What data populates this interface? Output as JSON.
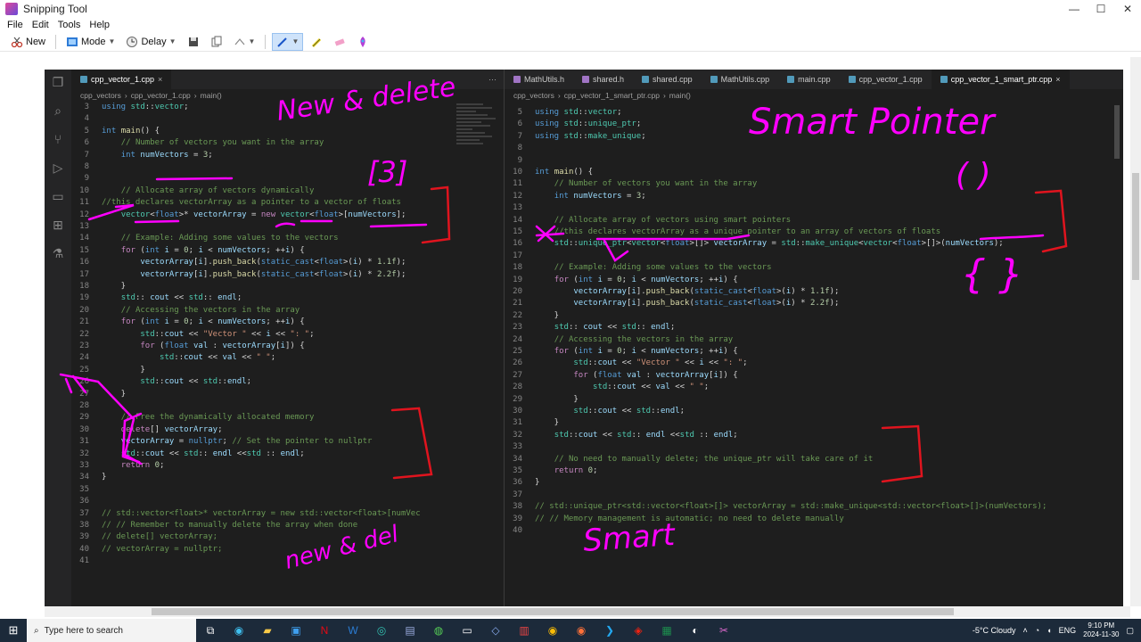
{
  "window": {
    "title": "Snipping Tool",
    "minimize": "—",
    "maximize": "☐",
    "close": "✕"
  },
  "menu": [
    "File",
    "Edit",
    "Tools",
    "Help"
  ],
  "toolbar": {
    "new_label": "New",
    "mode_label": "Mode",
    "delay_label": "Delay"
  },
  "left_editor": {
    "tab_label": "cpp_vector_1.cpp",
    "breadcrumb": [
      "cpp_vectors",
      "cpp_vector_1.cpp",
      "main()"
    ],
    "lines": [
      {
        "n": "3",
        "t": "using std::vector;"
      },
      {
        "n": "4",
        "t": ""
      },
      {
        "n": "5",
        "t": "int main() {"
      },
      {
        "n": "6",
        "t": "    // Number of vectors you want in the array"
      },
      {
        "n": "7",
        "t": "    int numVectors = 3;"
      },
      {
        "n": "8",
        "t": ""
      },
      {
        "n": "9",
        "t": ""
      },
      {
        "n": "10",
        "t": "    // Allocate array of vectors dynamically"
      },
      {
        "n": "11",
        "t": "//this declares vectorArray as a pointer to a vector of floats"
      },
      {
        "n": "12",
        "t": "    vector<float>* vectorArray = new vector<float>[numVectors];"
      },
      {
        "n": "13",
        "t": ""
      },
      {
        "n": "14",
        "t": "    // Example: Adding some values to the vectors"
      },
      {
        "n": "15",
        "t": "    for (int i = 0; i < numVectors; ++i) {"
      },
      {
        "n": "16",
        "t": "        vectorArray[i].push_back(static_cast<float>(i) * 1.1f);"
      },
      {
        "n": "17",
        "t": "        vectorArray[i].push_back(static_cast<float>(i) * 2.2f);"
      },
      {
        "n": "18",
        "t": "    }"
      },
      {
        "n": "19",
        "t": "    std:: cout << std:: endl;"
      },
      {
        "n": "20",
        "t": "    // Accessing the vectors in the array"
      },
      {
        "n": "21",
        "t": "    for (int i = 0; i < numVectors; ++i) {"
      },
      {
        "n": "22",
        "t": "        std::cout << \"Vector \" << i << \": \";"
      },
      {
        "n": "23",
        "t": "        for (float val : vectorArray[i]) {"
      },
      {
        "n": "24",
        "t": "            std::cout << val << \" \";"
      },
      {
        "n": "25",
        "t": "        }"
      },
      {
        "n": "26",
        "t": "        std::cout << std::endl;"
      },
      {
        "n": "27",
        "t": "    }"
      },
      {
        "n": "28",
        "t": ""
      },
      {
        "n": "29",
        "t": "    // Free the dynamically allocated memory"
      },
      {
        "n": "30",
        "t": "    delete[] vectorArray;"
      },
      {
        "n": "31",
        "t": "    vectorArray = nullptr; // Set the pointer to nullptr"
      },
      {
        "n": "32",
        "t": "    std::cout << std:: endl <<std :: endl;"
      },
      {
        "n": "33",
        "t": "    return 0;"
      },
      {
        "n": "34",
        "t": "}"
      },
      {
        "n": "35",
        "t": ""
      },
      {
        "n": "36",
        "t": ""
      },
      {
        "n": "37",
        "t": "// std::vector<float>* vectorArray = new std::vector<float>[numVec"
      },
      {
        "n": "38",
        "t": "// // Remember to manually delete the array when done"
      },
      {
        "n": "39",
        "t": "// delete[] vectorArray;"
      },
      {
        "n": "40",
        "t": "// vectorArray = nullptr;"
      },
      {
        "n": "41",
        "t": ""
      }
    ]
  },
  "right_editor": {
    "tabs": [
      "MathUtils.h",
      "shared.h",
      "shared.cpp",
      "MathUtils.cpp",
      "main.cpp",
      "cpp_vector_1.cpp",
      "cpp_vector_1_smart_ptr.cpp"
    ],
    "breadcrumb": [
      "cpp_vectors",
      "cpp_vector_1_smart_ptr.cpp",
      "main()"
    ],
    "lines": [
      {
        "n": "5",
        "t": "using std::vector;"
      },
      {
        "n": "6",
        "t": "using std::unique_ptr;"
      },
      {
        "n": "7",
        "t": "using std::make_unique;"
      },
      {
        "n": "8",
        "t": ""
      },
      {
        "n": "9",
        "t": ""
      },
      {
        "n": "10",
        "t": "int main() {"
      },
      {
        "n": "11",
        "t": "    // Number of vectors you want in the array"
      },
      {
        "n": "12",
        "t": "    int numVectors = 3;"
      },
      {
        "n": "13",
        "t": ""
      },
      {
        "n": "14",
        "t": "    // Allocate array of vectors using smart pointers"
      },
      {
        "n": "15",
        "t": "    //this declares vectorArray as a unique pointer to an array of vectors of floats"
      },
      {
        "n": "16",
        "t": "    std::unique_ptr<vector<float>[]> vectorArray = std::make_unique<vector<float>[]>(numVectors);"
      },
      {
        "n": "17",
        "t": ""
      },
      {
        "n": "18",
        "t": "    // Example: Adding some values to the vectors"
      },
      {
        "n": "19",
        "t": "    for (int i = 0; i < numVectors; ++i) {"
      },
      {
        "n": "20",
        "t": "        vectorArray[i].push_back(static_cast<float>(i) * 1.1f);"
      },
      {
        "n": "21",
        "t": "        vectorArray[i].push_back(static_cast<float>(i) * 2.2f);"
      },
      {
        "n": "22",
        "t": "    }"
      },
      {
        "n": "23",
        "t": "    std:: cout << std:: endl;"
      },
      {
        "n": "24",
        "t": "    // Accessing the vectors in the array"
      },
      {
        "n": "25",
        "t": "    for (int i = 0; i < numVectors; ++i) {"
      },
      {
        "n": "26",
        "t": "        std::cout << \"Vector \" << i << \": \";"
      },
      {
        "n": "27",
        "t": "        for (float val : vectorArray[i]) {"
      },
      {
        "n": "28",
        "t": "            std::cout << val << \" \";"
      },
      {
        "n": "29",
        "t": "        }"
      },
      {
        "n": "30",
        "t": "        std::cout << std::endl;"
      },
      {
        "n": "31",
        "t": "    }"
      },
      {
        "n": "32",
        "t": "    std::cout << std:: endl <<std :: endl;"
      },
      {
        "n": "33",
        "t": ""
      },
      {
        "n": "34",
        "t": "    // No need to manually delete; the unique_ptr will take care of it"
      },
      {
        "n": "35",
        "t": "    return 0;"
      },
      {
        "n": "36",
        "t": "}"
      },
      {
        "n": "37",
        "t": ""
      },
      {
        "n": "38",
        "t": "// std::unique_ptr<std::vector<float>[]> vectorArray = std::make_unique<std::vector<float>[]>(numVectors);"
      },
      {
        "n": "39",
        "t": "// // Memory management is automatic; no need to delete manually"
      },
      {
        "n": "40",
        "t": ""
      }
    ]
  },
  "annotations": {
    "new_delete": "New & delete",
    "bracket_3": "[3]",
    "smart_pointer": "Smart Pointer",
    "parens": "( )",
    "braces": "{ }",
    "new_del_bottom": "new & del",
    "smart_bottom": "Smart"
  },
  "taskbar": {
    "search_placeholder": "Type here to search",
    "weather": "-5°C  Cloudy",
    "language": "ENG",
    "time": "9:10 PM",
    "date": "2024-11-30"
  },
  "colors": {
    "annotation": "#ff00ff",
    "editor_bg": "#1e1e1e",
    "red_marker": "#e0141e"
  }
}
